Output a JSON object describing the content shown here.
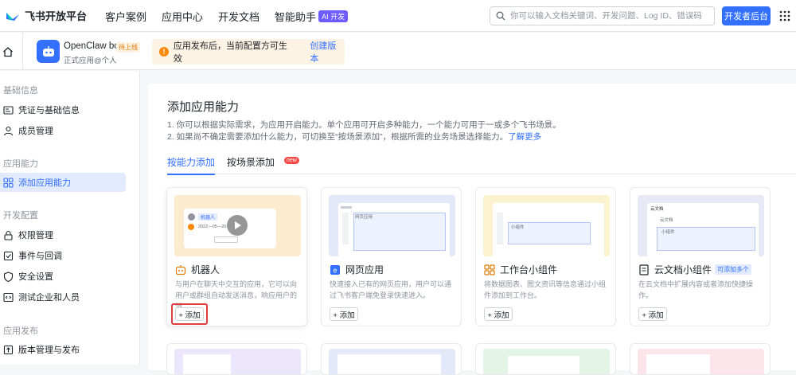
{
  "topbar": {
    "logo": "飞书开放平台",
    "nav": [
      "客户案例",
      "应用中心",
      "开发文档",
      "智能助手"
    ],
    "ai_badge": "AI 开发",
    "search_placeholder": "你可以输入文档关键词、开发问题、Log ID、错误码",
    "dev_console": "开发者后台"
  },
  "app": {
    "name": "OpenClaw bot",
    "status": "待上线",
    "subtitle": "正式应用@个人"
  },
  "notice": {
    "text": "应用发布后，当前配置方可生效",
    "link": "创建版本"
  },
  "sidebar": {
    "sections": [
      {
        "title": "基础信息",
        "items": [
          "凭证与基础信息",
          "成员管理"
        ]
      },
      {
        "title": "应用能力",
        "items": [
          "添加应用能力"
        ]
      },
      {
        "title": "开发配置",
        "items": [
          "权限管理",
          "事件与回调",
          "安全设置",
          "测试企业和人员"
        ]
      },
      {
        "title": "应用发布",
        "items": [
          "版本管理与发布"
        ]
      }
    ]
  },
  "main": {
    "title": "添加应用能力",
    "desc1": "1. 你可以根据实际需求，为应用开启能力。单个应用可开启多种能力，一个能力可用于一或多个飞书场景。",
    "desc2": "2. 如果尚不确定需要添加什么能力，可切换至“按场景添加”，根据所需的业务场景选择能力。",
    "learn_more": "了解更多",
    "tabs": [
      "按能力添加",
      "按场景添加"
    ],
    "new_badge": "new",
    "add_label": "+ 添加",
    "multi_badge": "可添加多个",
    "cards": [
      {
        "title": "机器人",
        "desc": "与用户在聊天中交互的应用，它可以向用户或群组自动发送消息，响应用户的消..."
      },
      {
        "title": "网页应用",
        "desc": "快速接入已有的网页应用，用户可以通过飞书客户端免登录快速进入。"
      },
      {
        "title": "工作台小组件",
        "desc": "将数据图表、图文资讯等信息通过小组件添加到工作台。"
      },
      {
        "title": "云文档小组件",
        "desc": "在云文档中扩展内容或者添加快捷操作。"
      }
    ],
    "preview_text": {
      "bot_name": "机器人",
      "bot_date": "2022—05—20",
      "web_label": "网页应用",
      "widget_label": "小组件",
      "doc_tab": "云文档",
      "doc_label": "云文档",
      "doc_widget": "小组件"
    }
  },
  "colors": {
    "accent": "#3370ff",
    "highlight": "#e03e3e",
    "warning": "#ff8800"
  }
}
